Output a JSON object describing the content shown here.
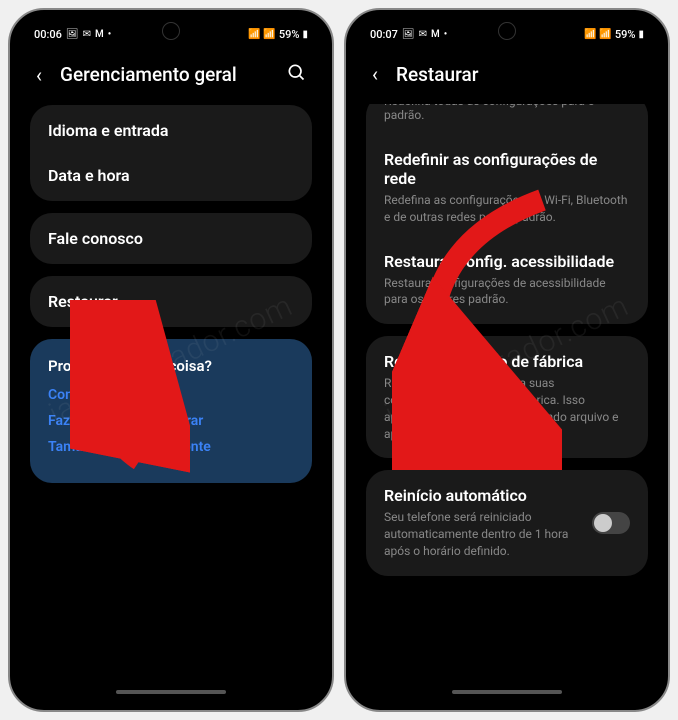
{
  "left": {
    "status": {
      "time": "00:06",
      "battery": "59%"
    },
    "header": {
      "title": "Gerenciamento geral"
    },
    "group1": {
      "item1": "Idioma e entrada",
      "item2": "Data e hora"
    },
    "group2": {
      "item1": "Fale conosco"
    },
    "group3": {
      "item1": "Restaurar"
    },
    "help": {
      "title": "Procurando outra coisa?",
      "link1": "Contas",
      "link2": "Fazer backup e restaurar",
      "link3": "Tamanho e estilo da fonte"
    }
  },
  "right": {
    "status": {
      "time": "00:07",
      "battery": "59%"
    },
    "header": {
      "title": "Restaurar"
    },
    "partial": "Redefina todas as configurações para o padrão.",
    "network": {
      "title": "Redefinir as configurações de rede",
      "desc": "Redefina as configurações de Wi-Fi, Bluetooth e de outras redes para o padrão."
    },
    "accessibility": {
      "title": "Restaurar config. acessibilidade",
      "desc": "Restaura configurações de acessibilidade para os valores padrão."
    },
    "factory": {
      "title": "Restaurar padrão de fábrica",
      "desc": "Redefina seu telefone para suas configurações padrão de fábrica. Isso apagará todos os dados, incluindo arquivo e aplicativos baixados."
    },
    "autorestart": {
      "title": "Reinício automático",
      "desc": "Seu telefone será reiniciado automaticamente dentro de 1 hora após o horário definido."
    }
  },
  "watermark": "iacomputador.com"
}
